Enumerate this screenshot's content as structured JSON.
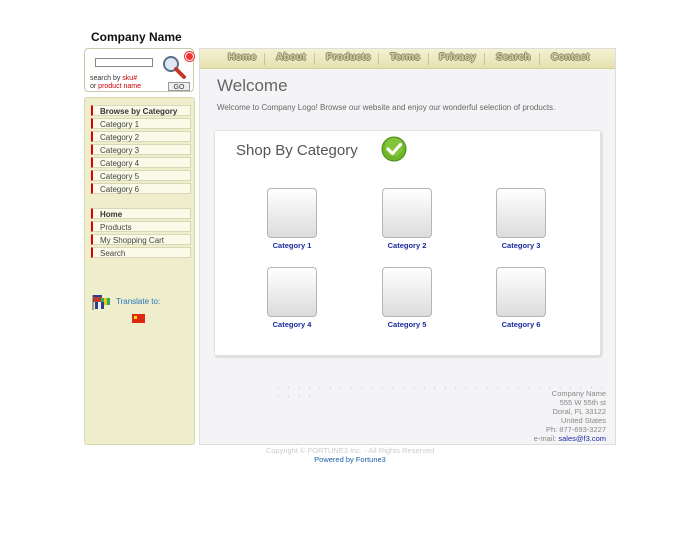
{
  "header": {
    "company_name": "Company Name"
  },
  "search": {
    "placeholder": "",
    "hint_prefix": "search by ",
    "hint_sku": "sku#",
    "hint_or": "or ",
    "hint_product": "product name",
    "go_label": "GO"
  },
  "sidebar": {
    "browse_heading": "Browse by Category",
    "categories": [
      "Category 1",
      "Category 2",
      "Category 3",
      "Category 4",
      "Category 5",
      "Category 6"
    ],
    "links": [
      "Home",
      "Products",
      "My Shopping Cart",
      "Search"
    ],
    "translate_label": "Translate to:"
  },
  "nav": [
    "Home",
    "About",
    "Products",
    "Terms",
    "Privacy",
    "Search",
    "Contact"
  ],
  "main": {
    "title": "Welcome",
    "intro": "Welcome to Company Logo! Browse our website and enjoy our wonderful selection of products.",
    "shop_title": "Shop By Category",
    "categories": [
      "Category 1",
      "Category 2",
      "Category 3",
      "Category 4",
      "Category 5",
      "Category 6"
    ]
  },
  "footer": {
    "dots": ". . . . . . . . . . . . . . . . . . . . . . . . . . . . . . . . . . . .",
    "address_name": "Company Name",
    "address_street": "555 W 55th st",
    "address_city": "Doral, FL 33122",
    "address_country": "United States",
    "phone": "Ph: 877-693-3227",
    "email_prefix": "e-mail: ",
    "email": "sales@f3.com",
    "copyright": "Copyright © FORTUNE3 Inc. - All Rights Reserved",
    "powered": "Powered by Fortune3"
  },
  "colors": {
    "accent_red": "#dd0000",
    "link_blue": "#1b2a9e",
    "sidebar_bg": "#eeeecc"
  }
}
